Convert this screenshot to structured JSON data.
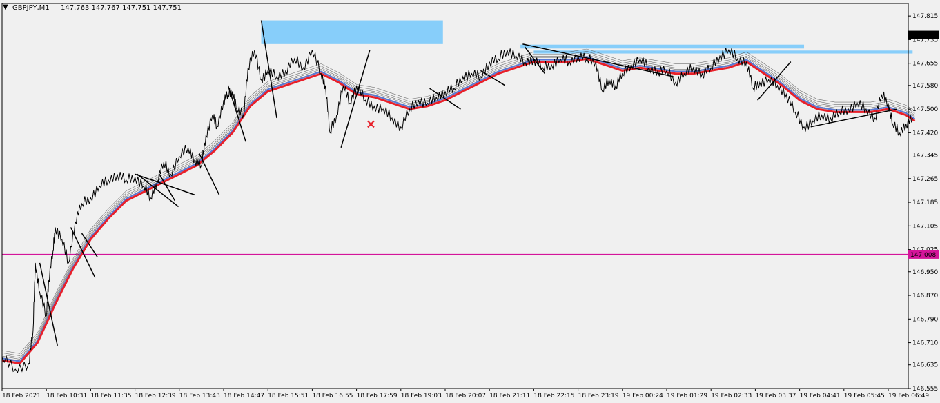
{
  "window": {
    "symbol_title": "GBPJPY,M1",
    "ohlc": "147.763 147.767 147.751 147.751"
  },
  "colors": {
    "background": "#f0f0f0",
    "price_line": "#000000",
    "bull_segment": "#1a8f1a",
    "ema_main": "#e8202a",
    "ema_blue": "#5a7ad8",
    "ema_band": "#444444",
    "zone_fill": "#87cefa",
    "magenta_level": "#d4159a",
    "current_price_line": "#6b7b8c",
    "trendline": "#000000",
    "marker": "#e8202a"
  },
  "chart_data": {
    "type": "line",
    "symbol": "GBPJPY",
    "timeframe": "M1",
    "ylim": [
      146.555,
      147.855
    ],
    "y_ticks": [
      "147.815",
      "147.735",
      "147.655",
      "147.580",
      "147.500",
      "147.420",
      "147.345",
      "147.265",
      "147.185",
      "147.105",
      "147.025",
      "146.950",
      "146.870",
      "146.790",
      "146.710",
      "146.635",
      "146.555"
    ],
    "x_ticks": [
      "18 Feb 2021",
      "18 Feb 10:31",
      "18 Feb 11:35",
      "18 Feb 12:39",
      "18 Feb 13:43",
      "18 Feb 14:47",
      "18 Feb 15:51",
      "18 Feb 16:55",
      "18 Feb 17:59",
      "18 Feb 19:03",
      "18 Feb 20:07",
      "18 Feb 21:11",
      "18 Feb 22:15",
      "18 Feb 23:19",
      "19 Feb 00:24",
      "19 Feb 01:29",
      "19 Feb 02:33",
      "19 Feb 03:37",
      "19 Feb 04:41",
      "19 Feb 05:45",
      "19 Feb 06:49"
    ],
    "x_count": 21,
    "current_price": 147.751,
    "current_price_label": "147.751",
    "horizontal_level": 147.008,
    "horizontal_level_label": "147.008",
    "price_series": [
      [
        0,
        146.66
      ],
      [
        0.3,
        146.62
      ],
      [
        0.6,
        146.64
      ],
      [
        0.7,
        146.75
      ],
      [
        0.75,
        146.98
      ],
      [
        0.85,
        146.88
      ],
      [
        1.0,
        146.8
      ],
      [
        1.05,
        146.92
      ],
      [
        1.15,
        147.02
      ],
      [
        1.2,
        147.1
      ],
      [
        1.35,
        147.06
      ],
      [
        1.5,
        146.98
      ],
      [
        1.65,
        147.12
      ],
      [
        1.8,
        147.18
      ],
      [
        2.0,
        147.2
      ],
      [
        2.2,
        147.24
      ],
      [
        2.4,
        147.26
      ],
      [
        2.6,
        147.28
      ],
      [
        2.8,
        147.26
      ],
      [
        3.0,
        147.27
      ],
      [
        3.2,
        147.24
      ],
      [
        3.35,
        147.2
      ],
      [
        3.5,
        147.26
      ],
      [
        3.65,
        147.32
      ],
      [
        3.8,
        147.28
      ],
      [
        4.0,
        147.34
      ],
      [
        4.2,
        147.37
      ],
      [
        4.35,
        147.33
      ],
      [
        4.5,
        147.31
      ],
      [
        4.6,
        147.41
      ],
      [
        4.75,
        147.48
      ],
      [
        4.85,
        147.44
      ],
      [
        5.0,
        147.53
      ],
      [
        5.1,
        147.55
      ],
      [
        5.2,
        147.56
      ],
      [
        5.3,
        147.5
      ],
      [
        5.45,
        147.48
      ],
      [
        5.55,
        147.64
      ],
      [
        5.7,
        147.7
      ],
      [
        5.85,
        147.6
      ],
      [
        6.0,
        147.63
      ],
      [
        6.2,
        147.61
      ],
      [
        6.4,
        147.63
      ],
      [
        6.6,
        147.67
      ],
      [
        6.8,
        147.64
      ],
      [
        7.0,
        147.7
      ],
      [
        7.2,
        147.62
      ],
      [
        7.3,
        147.58
      ],
      [
        7.4,
        147.42
      ],
      [
        7.55,
        147.48
      ],
      [
        7.7,
        147.58
      ],
      [
        7.85,
        147.52
      ],
      [
        8.0,
        147.58
      ],
      [
        8.2,
        147.53
      ],
      [
        8.4,
        147.51
      ],
      [
        8.6,
        147.5
      ],
      [
        8.8,
        147.47
      ],
      [
        9.0,
        147.44
      ],
      [
        9.2,
        147.5
      ],
      [
        9.4,
        147.53
      ],
      [
        9.6,
        147.52
      ],
      [
        9.8,
        147.54
      ],
      [
        10.0,
        147.56
      ],
      [
        10.2,
        147.57
      ],
      [
        10.4,
        147.61
      ],
      [
        10.6,
        147.62
      ],
      [
        10.8,
        147.61
      ],
      [
        11.0,
        147.66
      ],
      [
        11.2,
        147.67
      ],
      [
        11.4,
        147.7
      ],
      [
        11.6,
        147.68
      ],
      [
        11.8,
        147.66
      ],
      [
        12.0,
        147.67
      ],
      [
        12.2,
        147.64
      ],
      [
        12.4,
        147.65
      ],
      [
        12.6,
        147.67
      ],
      [
        12.8,
        147.66
      ],
      [
        13.0,
        147.68
      ],
      [
        13.2,
        147.67
      ],
      [
        13.4,
        147.66
      ],
      [
        13.55,
        147.56
      ],
      [
        13.7,
        147.6
      ],
      [
        13.85,
        147.58
      ],
      [
        14.0,
        147.62
      ],
      [
        14.2,
        147.65
      ],
      [
        14.4,
        147.67
      ],
      [
        14.6,
        147.64
      ],
      [
        14.8,
        147.63
      ],
      [
        15.0,
        147.63
      ],
      [
        15.2,
        147.59
      ],
      [
        15.4,
        147.62
      ],
      [
        15.6,
        147.64
      ],
      [
        15.8,
        147.62
      ],
      [
        16.0,
        147.64
      ],
      [
        16.2,
        147.68
      ],
      [
        16.4,
        147.7
      ],
      [
        16.6,
        147.67
      ],
      [
        16.8,
        147.66
      ],
      [
        16.95,
        147.57
      ],
      [
        17.1,
        147.59
      ],
      [
        17.3,
        147.6
      ],
      [
        17.5,
        147.58
      ],
      [
        17.7,
        147.55
      ],
      [
        17.9,
        147.49
      ],
      [
        18.1,
        147.44
      ],
      [
        18.3,
        147.46
      ],
      [
        18.5,
        147.48
      ],
      [
        18.7,
        147.47
      ],
      [
        18.9,
        147.49
      ],
      [
        19.1,
        147.5
      ],
      [
        19.3,
        147.52
      ],
      [
        19.5,
        147.5
      ],
      [
        19.7,
        147.47
      ],
      [
        19.85,
        147.55
      ],
      [
        20.0,
        147.52
      ],
      [
        20.1,
        147.45
      ],
      [
        20.25,
        147.42
      ],
      [
        20.4,
        147.45
      ],
      [
        20.55,
        147.47
      ]
    ],
    "ema_series": [
      [
        0,
        146.65
      ],
      [
        0.4,
        146.64
      ],
      [
        0.8,
        146.71
      ],
      [
        1.2,
        146.84
      ],
      [
        1.6,
        146.96
      ],
      [
        2.0,
        147.06
      ],
      [
        2.4,
        147.13
      ],
      [
        2.8,
        147.19
      ],
      [
        3.2,
        147.22
      ],
      [
        3.6,
        147.25
      ],
      [
        4.0,
        147.28
      ],
      [
        4.4,
        147.31
      ],
      [
        4.8,
        147.36
      ],
      [
        5.2,
        147.42
      ],
      [
        5.6,
        147.51
      ],
      [
        6.0,
        147.56
      ],
      [
        6.4,
        147.58
      ],
      [
        6.8,
        147.6
      ],
      [
        7.2,
        147.62
      ],
      [
        7.6,
        147.59
      ],
      [
        8.0,
        147.55
      ],
      [
        8.4,
        147.54
      ],
      [
        8.8,
        147.52
      ],
      [
        9.2,
        147.5
      ],
      [
        9.6,
        147.51
      ],
      [
        10.0,
        147.53
      ],
      [
        10.4,
        147.56
      ],
      [
        10.8,
        147.59
      ],
      [
        11.2,
        147.62
      ],
      [
        11.6,
        147.64
      ],
      [
        12.0,
        147.66
      ],
      [
        12.4,
        147.66
      ],
      [
        12.8,
        147.66
      ],
      [
        13.2,
        147.67
      ],
      [
        13.6,
        147.65
      ],
      [
        14.0,
        147.63
      ],
      [
        14.4,
        147.64
      ],
      [
        14.8,
        147.63
      ],
      [
        15.2,
        147.62
      ],
      [
        15.6,
        147.62
      ],
      [
        16.0,
        147.63
      ],
      [
        16.4,
        147.64
      ],
      [
        16.8,
        147.66
      ],
      [
        17.2,
        147.62
      ],
      [
        17.6,
        147.58
      ],
      [
        18.0,
        147.53
      ],
      [
        18.4,
        147.5
      ],
      [
        18.8,
        147.49
      ],
      [
        19.2,
        147.49
      ],
      [
        19.6,
        147.49
      ],
      [
        20.0,
        147.5
      ],
      [
        20.4,
        147.48
      ],
      [
        20.6,
        147.46
      ]
    ],
    "zones": [
      {
        "x0": 5.85,
        "x1": 9.95,
        "y0": 147.72,
        "y1": 147.8
      },
      {
        "x0": 11.7,
        "x1": 18.1,
        "y0": 147.705,
        "y1": 147.718
      },
      {
        "x0": 12.0,
        "x1": 20.55,
        "y0": 147.688,
        "y1": 147.698
      }
    ],
    "trendlines": [
      [
        [
          0.85,
          146.98
        ],
        [
          1.25,
          146.7
        ]
      ],
      [
        [
          1.55,
          147.1
        ],
        [
          2.1,
          146.93
        ]
      ],
      [
        [
          1.8,
          147.08
        ],
        [
          2.15,
          147.0
        ]
      ],
      [
        [
          3.0,
          147.28
        ],
        [
          4.35,
          147.21
        ]
      ],
      [
        [
          3.05,
          147.28
        ],
        [
          3.98,
          147.17
        ]
      ],
      [
        [
          3.55,
          147.28
        ],
        [
          3.9,
          147.19
        ]
      ],
      [
        [
          4.45,
          147.35
        ],
        [
          4.9,
          147.21
        ]
      ],
      [
        [
          5.1,
          147.58
        ],
        [
          5.5,
          147.39
        ]
      ],
      [
        [
          5.85,
          147.8
        ],
        [
          6.2,
          147.47
        ]
      ],
      [
        [
          7.65,
          147.37
        ],
        [
          8.3,
          147.7
        ]
      ],
      [
        [
          9.65,
          147.57
        ],
        [
          10.35,
          147.5
        ]
      ],
      [
        [
          10.8,
          147.63
        ],
        [
          11.35,
          147.58
        ]
      ],
      [
        [
          11.8,
          147.71
        ],
        [
          12.25,
          147.62
        ]
      ],
      [
        [
          11.75,
          147.72
        ],
        [
          15.15,
          147.61
        ]
      ],
      [
        [
          17.05,
          147.53
        ],
        [
          17.8,
          147.66
        ]
      ],
      [
        [
          18.25,
          147.44
        ],
        [
          20.2,
          147.5
        ]
      ]
    ],
    "marker": {
      "x": 8.3,
      "y": 147.45,
      "symbol": "×"
    }
  }
}
